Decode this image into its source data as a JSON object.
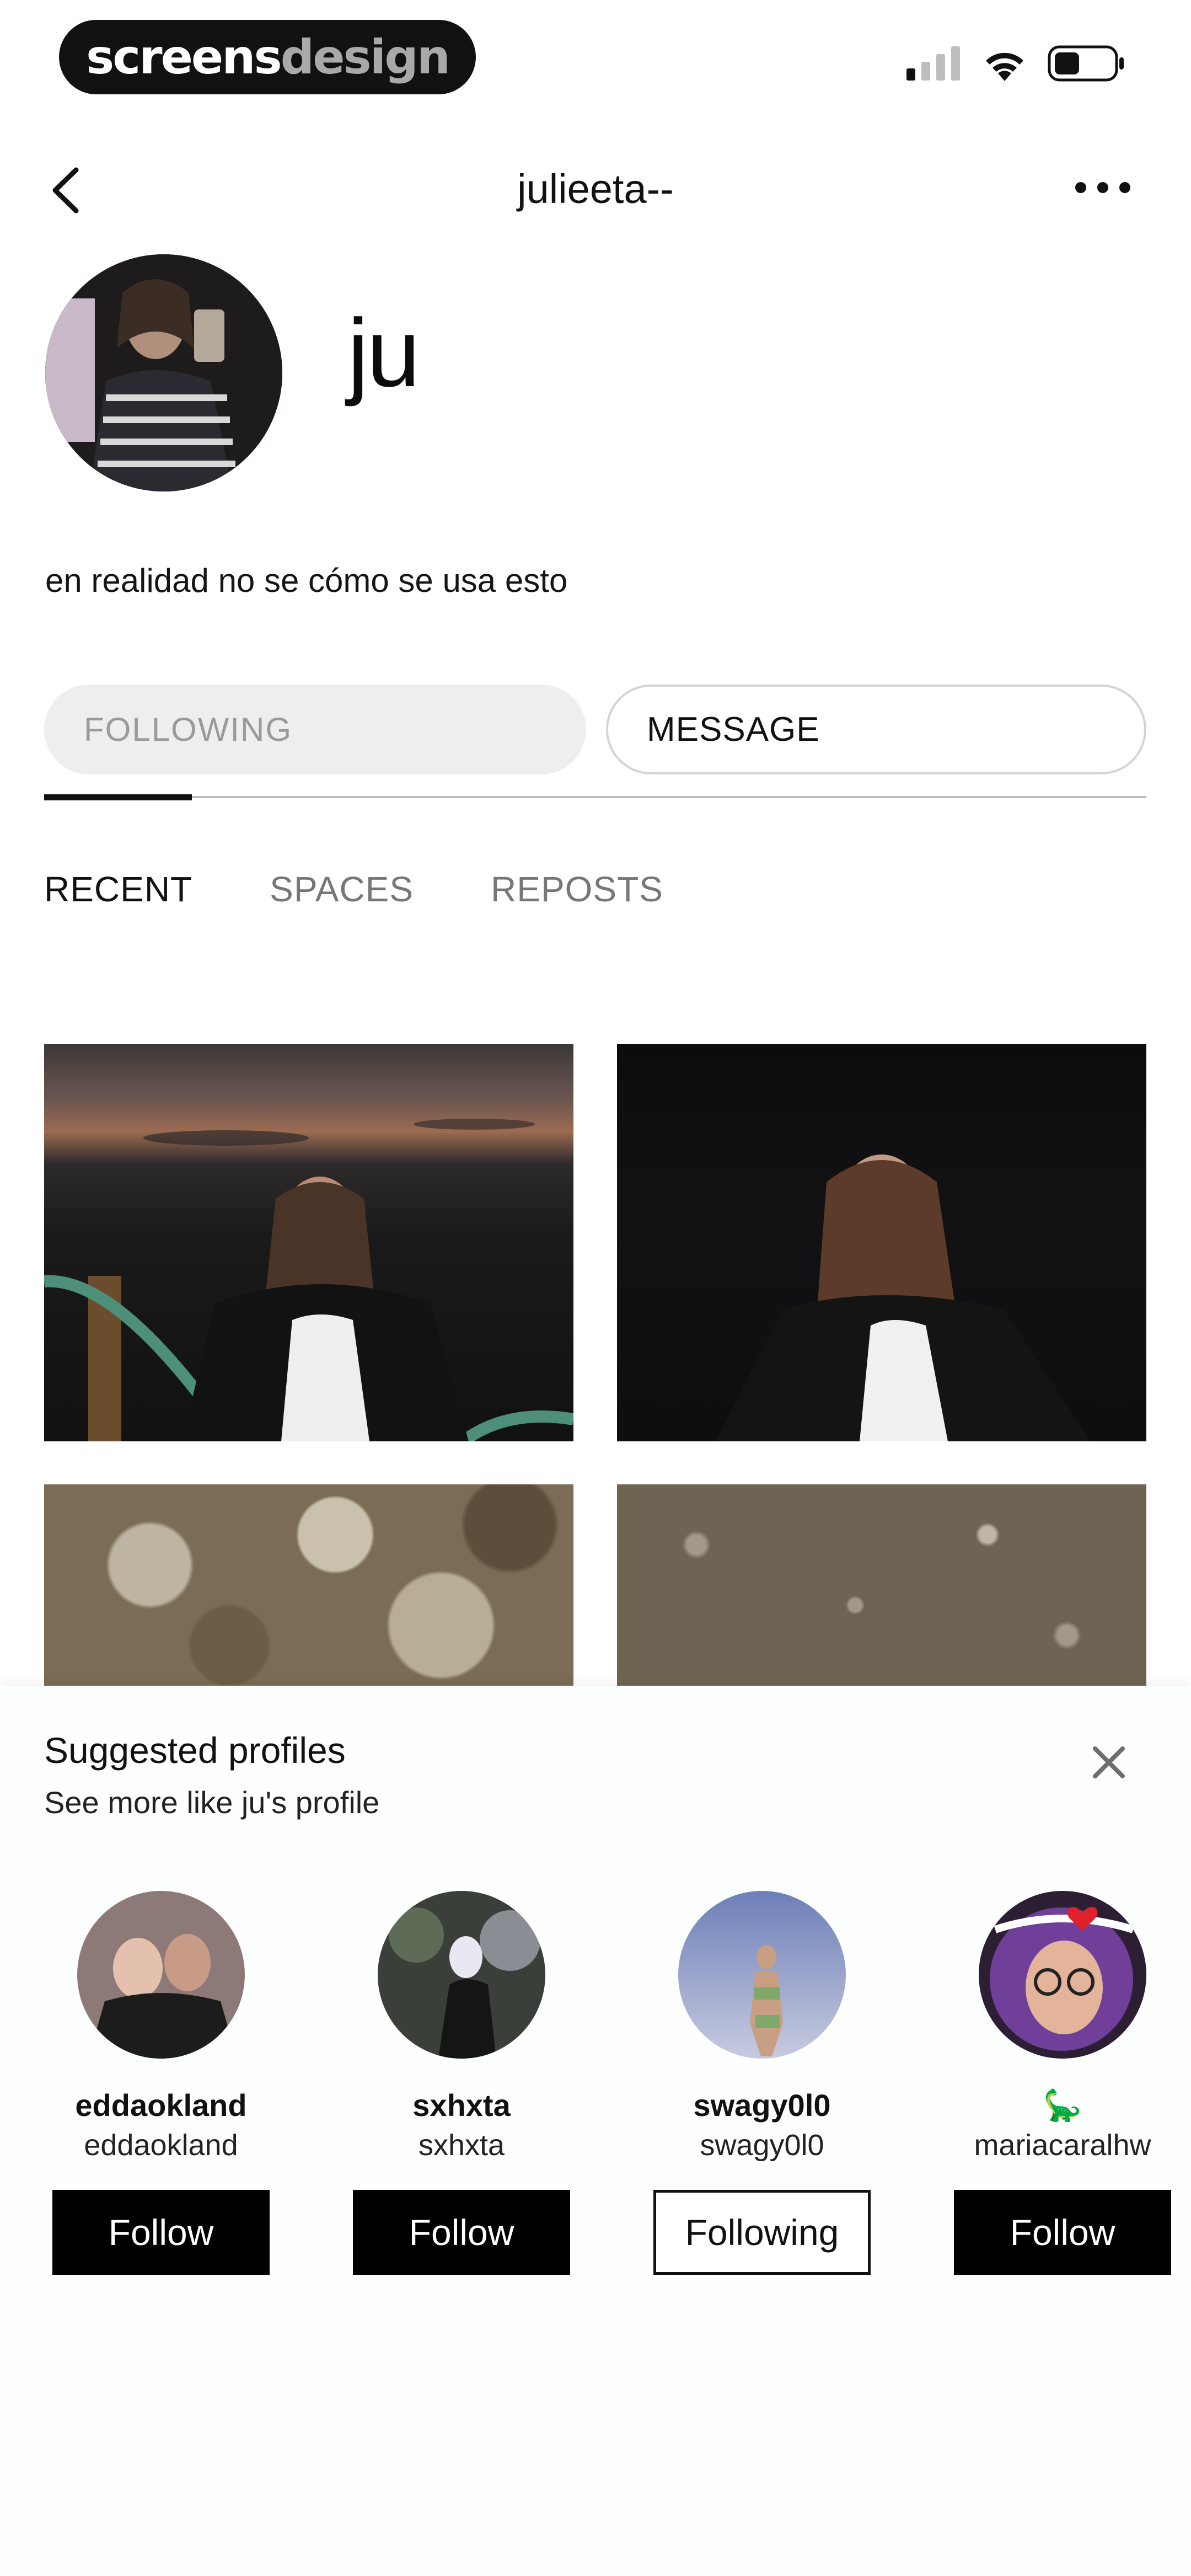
{
  "status_bar": {
    "brand_part1": "screens",
    "brand_part2": "design",
    "icons": [
      "cellular-signal-icon",
      "wifi-icon",
      "battery-icon"
    ]
  },
  "nav": {
    "title": "julieeta--",
    "back_icon": "chevron-left-icon",
    "more_icon": "more-horizontal-icon"
  },
  "profile": {
    "display_name": "ju",
    "bio": "en realidad no se cómo se usa esto"
  },
  "actions": {
    "following_label": "FOLLOWING",
    "message_label": "MESSAGE"
  },
  "tabs": [
    {
      "label": "RECENT",
      "active": true
    },
    {
      "label": "SPACES",
      "active": false
    },
    {
      "label": "REPOSTS",
      "active": false
    }
  ],
  "suggested": {
    "title": "Suggested profiles",
    "subtitle": "See more like ju's profile",
    "close_icon": "close-icon",
    "profiles": [
      {
        "name": "eddaokland",
        "handle": "eddaokland",
        "button": "Follow",
        "following": false
      },
      {
        "name": "sxhxta",
        "handle": "sxhxta",
        "button": "Follow",
        "following": false
      },
      {
        "name": "swagy0l0",
        "handle": "swagy0l0",
        "button": "Following",
        "following": true
      },
      {
        "name": "🦕",
        "handle": "mariacaralhw",
        "button": "Follow",
        "following": false
      }
    ]
  }
}
